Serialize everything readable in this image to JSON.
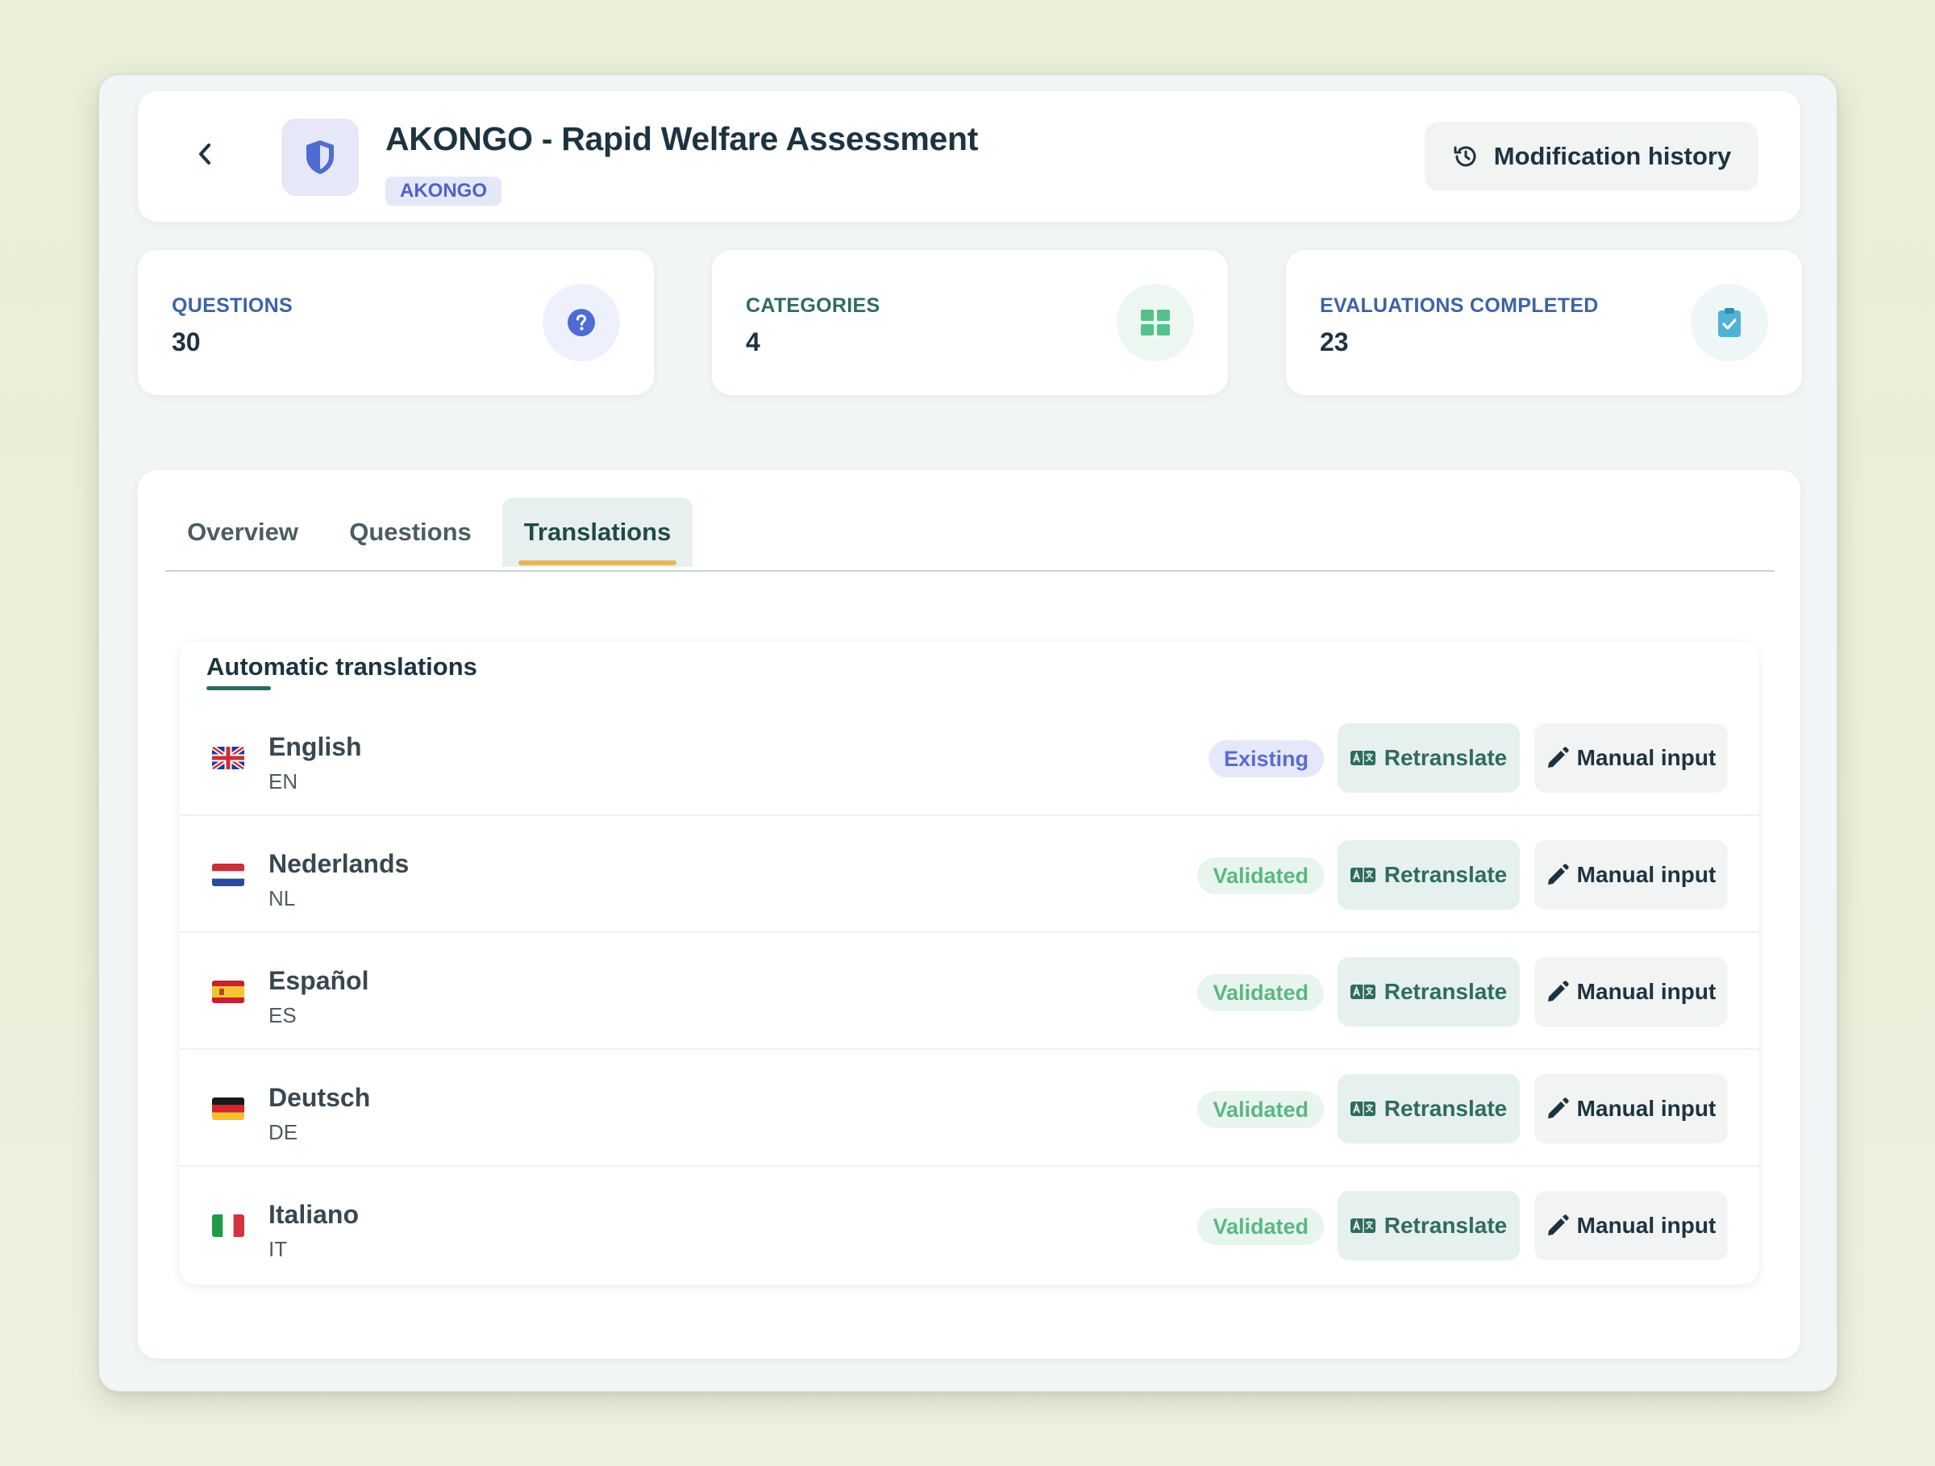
{
  "header": {
    "back_icon": "chevron-left-icon",
    "logo_icon": "shield-icon",
    "title": "AKONGO - Rapid Welfare Assessment",
    "code": "AKONGO",
    "history_button": "Modification history",
    "history_icon": "history-icon"
  },
  "stats": [
    {
      "label": "QUESTIONS",
      "value": "30",
      "icon": "question-circle-icon",
      "color": "#3d63a6",
      "icon_color": "#4f6cd2",
      "icon_bg": "#eef1fb"
    },
    {
      "label": "CATEGORIES",
      "value": "4",
      "icon": "grid-icon",
      "color": "#2e6c5f",
      "icon_color": "#55c08b",
      "icon_bg": "#edf7f1"
    },
    {
      "label": "EVALUATIONS COMPLETED",
      "value": "23",
      "icon": "clipboard-check-icon",
      "color": "#3d63a6",
      "icon_color": "#4fb3d4",
      "icon_bg": "#eef6f8"
    }
  ],
  "tabs": [
    {
      "label": "Overview",
      "active": false
    },
    {
      "label": "Questions",
      "active": false
    },
    {
      "label": "Translations",
      "active": true
    }
  ],
  "translations": {
    "title": "Automatic translations",
    "retranslate_label": "Retranslate",
    "manual_label": "Manual input",
    "languages": [
      {
        "name": "English",
        "code": "EN",
        "flag": "flag-uk-icon",
        "status": "Existing"
      },
      {
        "name": "Nederlands",
        "code": "NL",
        "flag": "flag-nl-icon",
        "status": "Validated"
      },
      {
        "name": "Español",
        "code": "ES",
        "flag": "flag-es-icon",
        "status": "Validated"
      },
      {
        "name": "Deutsch",
        "code": "DE",
        "flag": "flag-de-icon",
        "status": "Validated"
      },
      {
        "name": "Italiano",
        "code": "IT",
        "flag": "flag-it-icon",
        "status": "Validated"
      }
    ]
  },
  "colors": {
    "accent": "#2e6c5f",
    "tab_indicator": "#e2b84f",
    "existing": "#5a6cd0",
    "validated": "#5ab785"
  }
}
